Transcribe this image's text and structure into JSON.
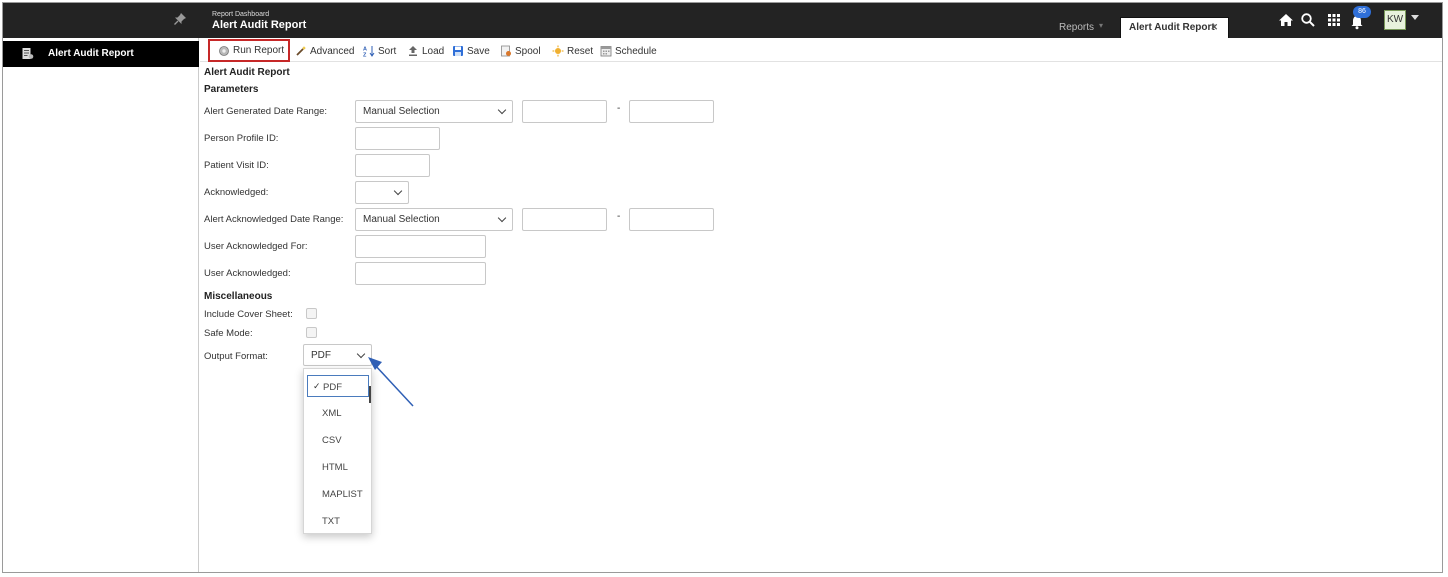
{
  "header": {
    "breadcrumb": "Report Dashboard",
    "title": "Alert Audit Report",
    "reports_label": "Reports",
    "open_tab_label": "Alert Audit Report",
    "notification_count": "86",
    "avatar_initials": "KW"
  },
  "sidebar": {
    "items": [
      {
        "label": "Alert Audit Report"
      }
    ]
  },
  "toolbar": {
    "run_report": "Run Report",
    "advanced": "Advanced",
    "sort": "Sort",
    "load": "Load",
    "save": "Save",
    "spool": "Spool",
    "reset": "Reset",
    "schedule": "Schedule"
  },
  "form": {
    "report_title": "Alert Audit Report",
    "parameters_heading": "Parameters",
    "alert_generated_label": "Alert Generated Date Range:",
    "alert_generated_value": "Manual Selection",
    "person_profile_label": "Person Profile ID:",
    "patient_visit_label": "Patient Visit ID:",
    "acknowledged_label": "Acknowledged:",
    "alert_acknowledged_label": "Alert Acknowledged Date Range:",
    "alert_acknowledged_value": "Manual Selection",
    "user_ack_for_label": "User Acknowledged For:",
    "user_ack_label": "User Acknowledged:",
    "range_separator": "-",
    "misc_heading": "Miscellaneous",
    "cover_sheet_label": "Include Cover Sheet:",
    "safe_mode_label": "Safe Mode:",
    "output_format_label": "Output Format:",
    "output_format_value": "PDF",
    "output_format_options": [
      "PDF",
      "XML",
      "CSV",
      "HTML",
      "MAPLIST",
      "TXT"
    ]
  },
  "colors": {
    "header_bg": "#232323",
    "highlight_border": "#c62828",
    "annotation_arrow": "#2f5fb5",
    "badge": "#2f6fd8"
  }
}
